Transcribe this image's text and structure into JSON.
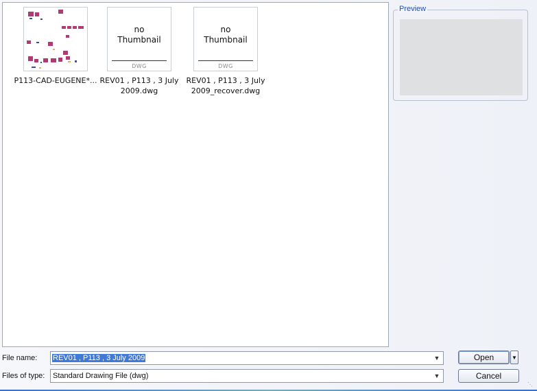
{
  "browser": {
    "files": [
      {
        "label": "P113-CAD-EUGENE*...",
        "has_thumbnail": true
      },
      {
        "label": "REV01 , P113 , 3 July\n2009.dwg",
        "has_thumbnail": false,
        "thumb_text": "no\nThumbnail",
        "thumb_tag": "DWG"
      },
      {
        "label": "REV01 , P113 , 3 July\n2009_recover.dwg",
        "has_thumbnail": false,
        "thumb_text": "no\nThumbnail",
        "thumb_tag": "DWG"
      }
    ]
  },
  "preview": {
    "legend": "Preview"
  },
  "file_name": {
    "label": "File name:",
    "value": "REV01 , P113 , 3 July 2009"
  },
  "files_of_type": {
    "label": "Files of type:",
    "value": "Standard Drawing File (dwg)"
  },
  "buttons": {
    "open": "Open",
    "cancel": "Cancel"
  },
  "icons": {
    "dropdown": "chevron-down-icon",
    "split": "triangle-down-icon",
    "grip": "resize-grip-icon"
  }
}
